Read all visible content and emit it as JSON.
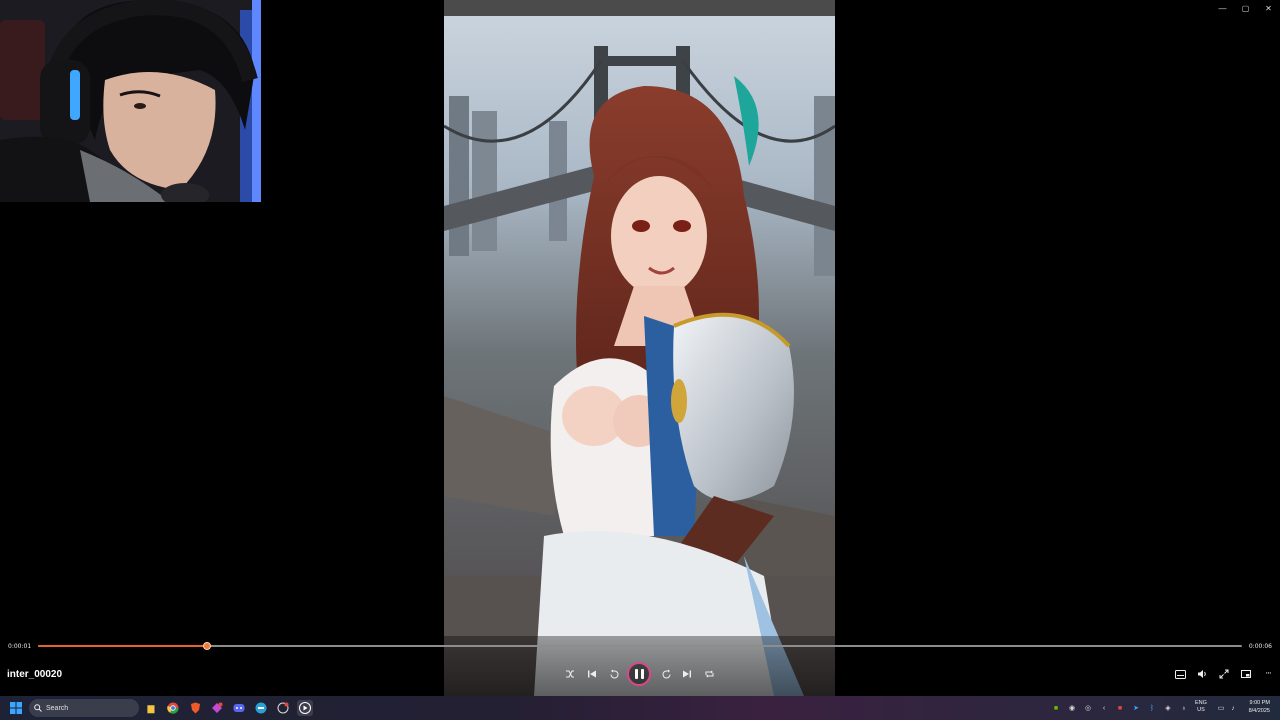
{
  "window": {
    "minimize_glyph": "—",
    "maximize_glyph": "▢",
    "close_glyph": "✕"
  },
  "player": {
    "title": "inter_00020",
    "current_time": "0:00:01",
    "total_time": "0:00:06",
    "progress_fraction": 0.14,
    "accent_color": "#e8622f",
    "controls": {
      "shuffle_icon": "shuffle-icon",
      "previous_icon": "skip-previous-icon",
      "rewind_icon": "rewind-10-icon",
      "pause_icon": "pause-icon",
      "forward_icon": "forward-30-icon",
      "next_icon": "skip-next-icon",
      "repeat_icon": "repeat-icon",
      "subtitles_icon": "subtitles-icon",
      "volume_icon": "volume-icon",
      "fullscreen_icon": "fullscreen-icon",
      "miniplayer_icon": "miniplayer-icon",
      "more_icon": "more-options-icon"
    }
  },
  "taskbar": {
    "search_placeholder": "Search",
    "language_line1": "ENG",
    "language_line2": "US",
    "time": "9:00 PM",
    "date": "8/4/2025"
  }
}
